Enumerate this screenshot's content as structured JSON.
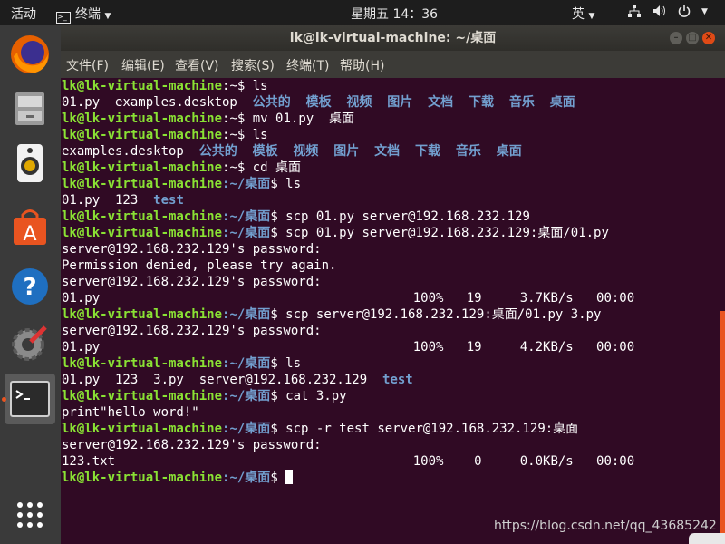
{
  "topbar": {
    "activities": "活动",
    "app_menu": "终端",
    "clock": "星期五 14：36",
    "input_method": "英"
  },
  "window": {
    "title": "lk@lk-virtual-machine: ~/桌面",
    "menu": [
      "文件(F)",
      "编辑(E)",
      "查看(V)",
      "搜索(S)",
      "终端(T)",
      "帮助(H)"
    ]
  },
  "terminal": {
    "l1": {
      "user": "lk@lk-virtual-machine",
      "path": ":~$",
      "cmd": " ls"
    },
    "l2": {
      "a": "01.py  examples.desktop  ",
      "dirs": "公共的  模板  视频  图片  文档  下载  音乐  桌面"
    },
    "l3": {
      "user": "lk@lk-virtual-machine",
      "path": ":~$",
      "cmd": " mv 01.py  桌面"
    },
    "l4": {
      "user": "lk@lk-virtual-machine",
      "path": ":~$",
      "cmd": " ls"
    },
    "l5": {
      "a": "examples.desktop  ",
      "dirs": "公共的  模板  视频  图片  文档  下载  音乐  桌面"
    },
    "l6": {
      "user": "lk@lk-virtual-machine",
      "path": ":~$",
      "cmd": " cd 桌面"
    },
    "l7": {
      "user": "lk@lk-virtual-machine",
      "path": ":~/桌面",
      "cmd": "$ ls"
    },
    "l8": {
      "a": "01.py  123  ",
      "dirs": "test"
    },
    "l9": {
      "user": "lk@lk-virtual-machine",
      "path": ":~/桌面",
      "cmd": "$ scp 01.py server@192.168.232.129"
    },
    "l10": {
      "user": "lk@lk-virtual-machine",
      "path": ":~/桌面",
      "cmd": "$ scp 01.py server@192.168.232.129:桌面/01.py"
    },
    "l11": "server@192.168.232.129's password:",
    "l12": "Permission denied, please try again.",
    "l13": "server@192.168.232.129's password:",
    "l14": "01.py                                         100%   19     3.7KB/s   00:00",
    "l15": {
      "user": "lk@lk-virtual-machine",
      "path": ":~/桌面",
      "cmd": "$ scp server@192.168.232.129:桌面/01.py 3.py"
    },
    "l16": "server@192.168.232.129's password:",
    "l17": "01.py                                         100%   19     4.2KB/s   00:00",
    "l18": {
      "user": "lk@lk-virtual-machine",
      "path": ":~/桌面",
      "cmd": "$ ls"
    },
    "l19": {
      "a": "01.py  123  3.py  server@192.168.232.129  ",
      "dirs": "test"
    },
    "l20": {
      "user": "lk@lk-virtual-machine",
      "path": ":~/桌面",
      "cmd": "$ cat 3.py"
    },
    "l21": "print\"hello word!\"",
    "l22": {
      "user": "lk@lk-virtual-machine",
      "path": ":~/桌面",
      "cmd": "$ scp -r test server@192.168.232.129:桌面"
    },
    "l23": "server@192.168.232.129's password:",
    "l24": "123.txt                                       100%    0     0.0KB/s   00:00",
    "l25": {
      "user": "lk@lk-virtual-machine",
      "path": ":~/桌面",
      "cmd": "$ "
    }
  },
  "watermark": "https://blog.csdn.net/qq_43685242",
  "colors": {
    "terminal_bg": "#300a24",
    "user": "#8ae234",
    "dir": "#729fcf",
    "accent": "#e95420"
  }
}
